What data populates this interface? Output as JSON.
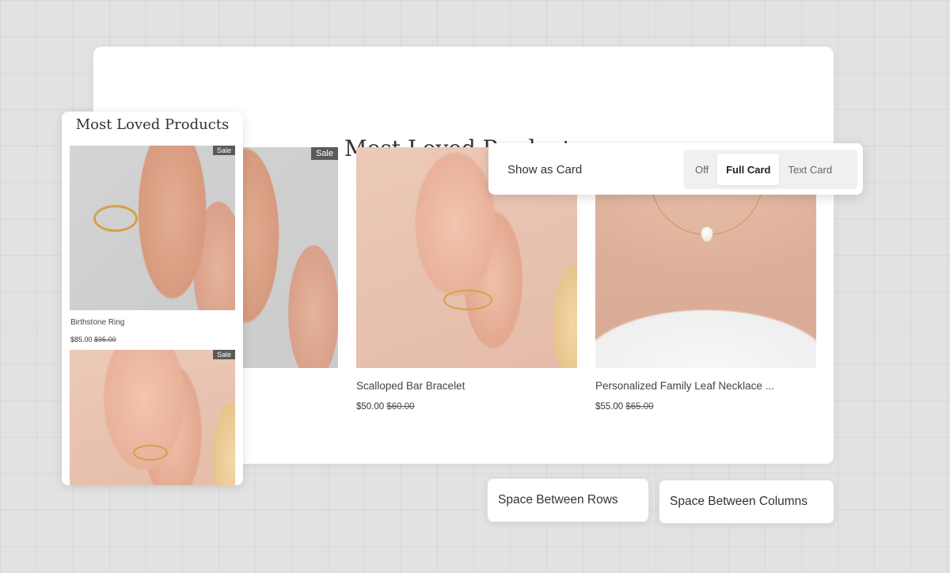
{
  "main": {
    "title": "Most Loved Products",
    "products": [
      {
        "name": "",
        "price": "",
        "old_price": "",
        "sale": "Sale"
      },
      {
        "name": "Scalloped Bar Bracelet",
        "price": "$50.00",
        "old_price": "$60.00"
      },
      {
        "name": "Personalized Family Leaf Necklace ...",
        "price": "$55.00",
        "old_price": "$65.00"
      }
    ]
  },
  "mobile": {
    "title": "Most Loved Products",
    "products": [
      {
        "name": "Birthstone Ring",
        "price": "$85.00",
        "old_price": "$95.00",
        "sale": "Sale"
      },
      {
        "sale": "Sale"
      }
    ]
  },
  "card_control": {
    "label": "Show as Card",
    "options": [
      "Off",
      "Full Card",
      "Text Card"
    ],
    "selected": "Full Card"
  },
  "spacing": {
    "rows_label": "Space Between Rows",
    "columns_label": "Space Between Columns"
  },
  "colors": {
    "badge": "#5a5a5a",
    "background": "#e2e2e2"
  }
}
